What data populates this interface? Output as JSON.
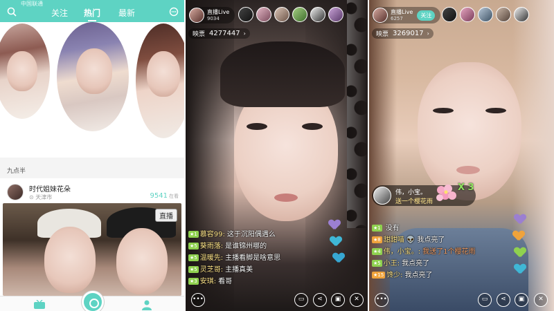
{
  "home": {
    "status_carrier": "中国联通",
    "tabs": [
      {
        "label": "关注"
      },
      {
        "label": "热门"
      },
      {
        "label": "最新"
      }
    ],
    "section_title": "九点半",
    "card": {
      "title": "时代姐妹花朵",
      "location": "天津市",
      "count": "9541",
      "count_unit": "在看",
      "live_tag": "直播"
    },
    "bottom_icons": [
      "tv-icon",
      "camera-icon",
      "profile-icon"
    ]
  },
  "live1": {
    "host_name": "直播Live",
    "host_id": "9034",
    "stat_label": "映票",
    "stat_value": "4277447",
    "chat": [
      {
        "level": "★1",
        "user": "慕容99:",
        "text": "这于沉阳偶遇么"
      },
      {
        "level": "★5",
        "user": "葵雨落:",
        "text": "是谁锦州哪的"
      },
      {
        "level": "★5",
        "user": "温暖先:",
        "text": "主播看脚是啥意思"
      },
      {
        "level": "★5",
        "user": "灵芝哥:",
        "text": "主播真美"
      },
      {
        "level": "★3",
        "user": "安琪:",
        "text": "看哥"
      }
    ],
    "heart_colors": [
      "#9b7fd1",
      "#3fb7d6",
      "#37a7d2"
    ]
  },
  "live2": {
    "host_name": "直播Live",
    "host_id": "6257",
    "follow_label": "关注",
    "stat_label": "映票",
    "stat_value": "3269017",
    "gift": {
      "user": "伟，小宝。",
      "text": "送一个樱花雨",
      "multiplier": "X 3"
    },
    "chat": [
      {
        "level": "★1",
        "user": "",
        "text": "没有"
      },
      {
        "level": "★8",
        "user": "甜甜喵",
        "text": "👽 我点亮了"
      },
      {
        "level": "★4",
        "user": "伟，小宝。:",
        "text": "我送了1个樱花雨"
      },
      {
        "level": "★5",
        "user": "小王:",
        "text": "我点亮了"
      },
      {
        "level": "★15",
        "user": "馋少:",
        "text": "我点亮了"
      }
    ],
    "heart_colors": [
      "#9b7fd1",
      "#f0a33b",
      "#8fd14f",
      "#3fb7d6"
    ]
  },
  "colors": {
    "accent": "#5ed3c3"
  }
}
